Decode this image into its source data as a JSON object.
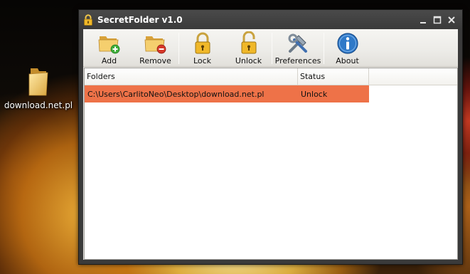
{
  "desktop": {
    "icon_label": "download.net.pl"
  },
  "window": {
    "title": "SecretFolder v1.0",
    "controls": [
      "minimize-icon",
      "maximize-icon",
      "close-icon"
    ]
  },
  "toolbar": {
    "add_label": "Add",
    "remove_label": "Remove",
    "lock_label": "Lock",
    "unlock_label": "Unlock",
    "preferences_label": "Preferences",
    "about_label": "About"
  },
  "list": {
    "columns": [
      "Folders",
      "Status"
    ],
    "rows": [
      {
        "folder": "C:\\Users\\CarlitoNeo\\Desktop\\download.net.pl",
        "status": "Unlock"
      }
    ]
  },
  "colors": {
    "selected_row": "#ee7248",
    "titlebar": "#3a3a3a",
    "toolbar": "#ecebe7"
  }
}
